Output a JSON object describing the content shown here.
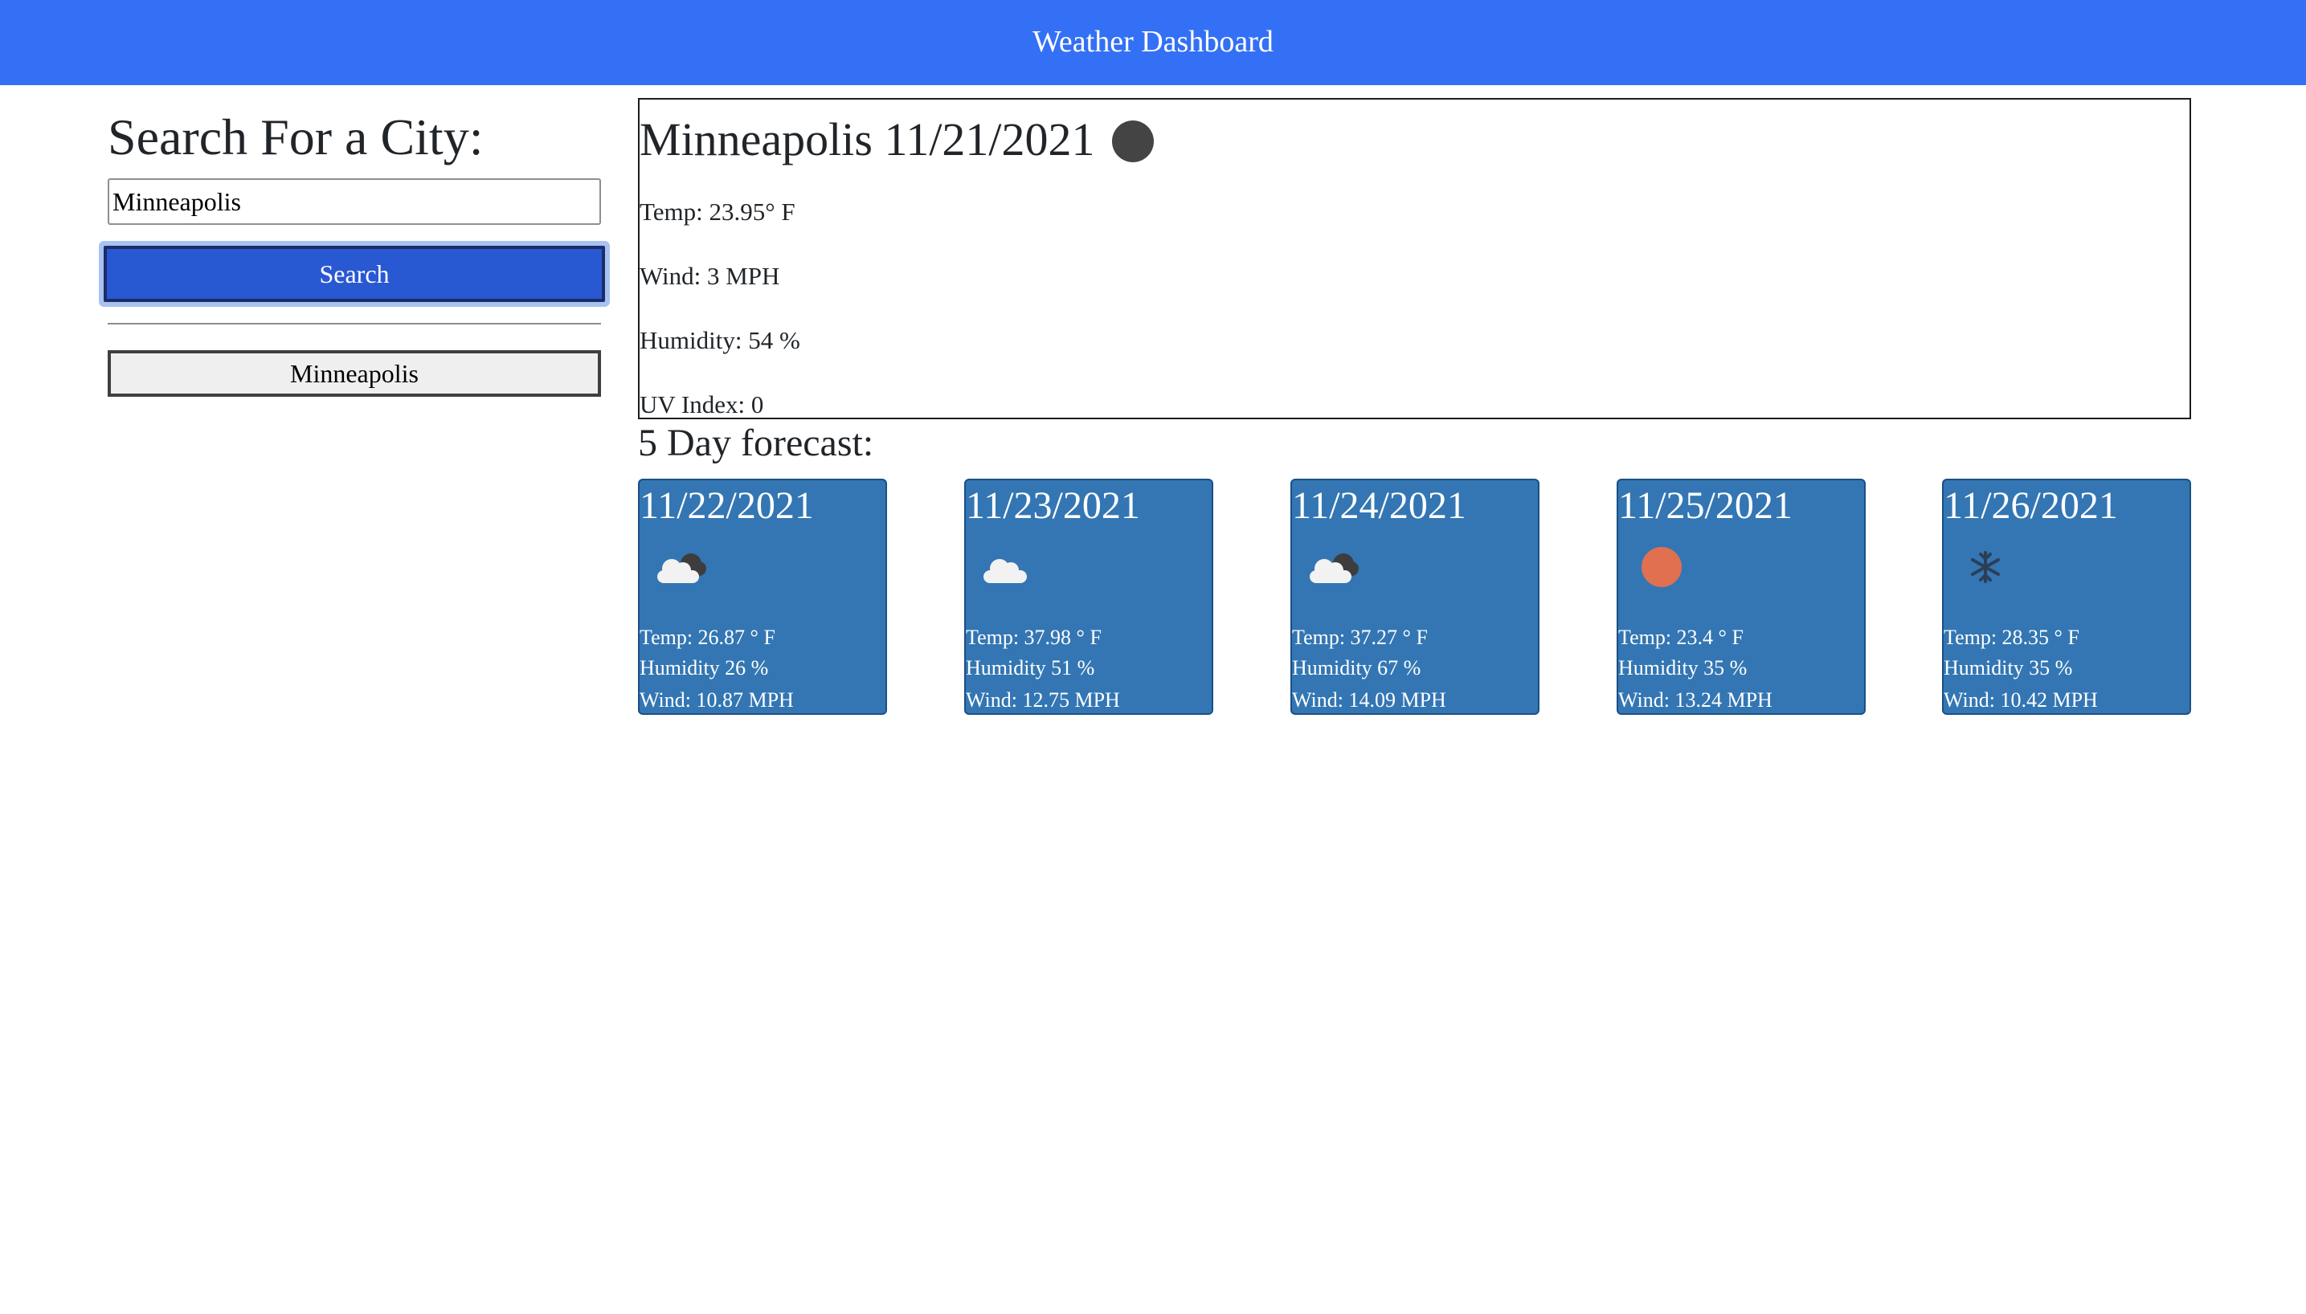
{
  "header": {
    "title": "Weather Dashboard"
  },
  "search": {
    "heading": "Search For a City:",
    "input_value": "Minneapolis",
    "button_label": "Search",
    "history": [
      "Minneapolis"
    ]
  },
  "current": {
    "city_date": "Minneapolis 11/21/2021",
    "icon": "moon-night-icon",
    "temp": "Temp: 23.95° F",
    "wind": "Wind: 3 MPH",
    "humidity": "Humidity: 54 %",
    "uv": "UV Index: 0"
  },
  "forecast": {
    "title": "5 Day forecast:",
    "days": [
      {
        "date": "11/22/2021",
        "icon": "partly-cloudy-dark-icon",
        "temp": "Temp: 26.87 ° F",
        "humidity": "Humidity 26 %",
        "wind": "Wind: 10.87 MPH"
      },
      {
        "date": "11/23/2021",
        "icon": "cloud-icon",
        "temp": "Temp: 37.98 ° F",
        "humidity": "Humidity 51 %",
        "wind": "Wind: 12.75 MPH"
      },
      {
        "date": "11/24/2021",
        "icon": "partly-cloudy-dark-icon",
        "temp": "Temp: 37.27 ° F",
        "humidity": "Humidity 67 %",
        "wind": "Wind: 14.09 MPH"
      },
      {
        "date": "11/25/2021",
        "icon": "sun-icon",
        "temp": "Temp: 23.4 ° F",
        "humidity": "Humidity 35 %",
        "wind": "Wind: 13.24 MPH"
      },
      {
        "date": "11/26/2021",
        "icon": "snowflake-icon",
        "temp": "Temp: 28.35 ° F",
        "humidity": "Humidity 35 %",
        "wind": "Wind: 10.42 MPH"
      }
    ]
  },
  "colors": {
    "header_bg": "#3370f5",
    "card_bg": "#3376b3",
    "search_button": "#2958d3",
    "sun": "#e07050",
    "moon": "#444444"
  }
}
